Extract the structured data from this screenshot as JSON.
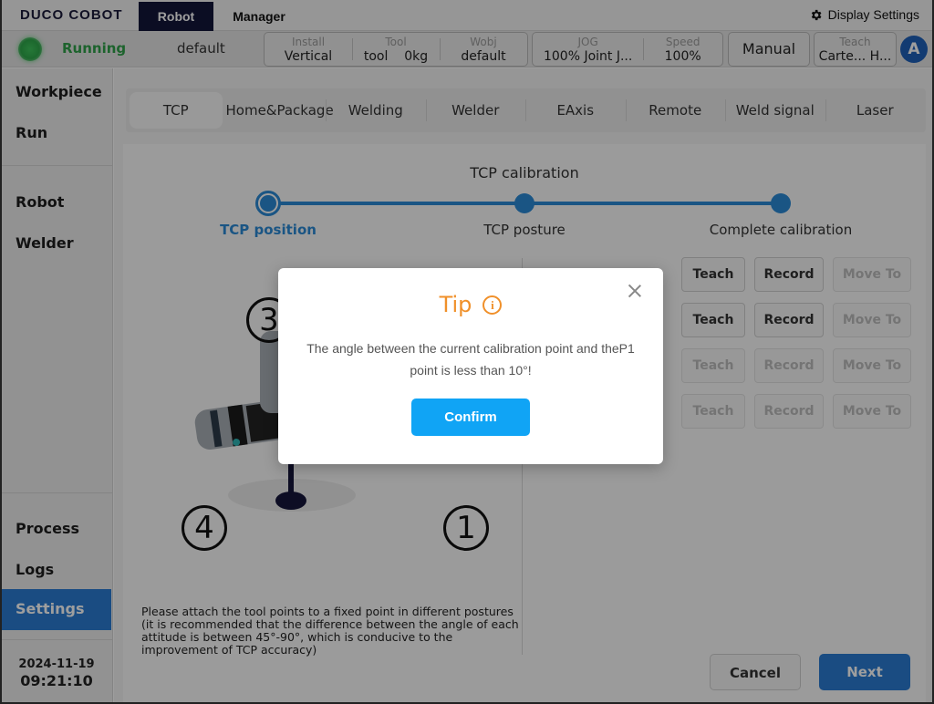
{
  "topbar": {
    "logo": "DUCO COBOT",
    "tabs": [
      {
        "label": "Robot"
      },
      {
        "label": "Manager"
      }
    ],
    "display_settings": "Display Settings"
  },
  "status": {
    "state": "Running",
    "profile": "default",
    "install": {
      "label": "Install",
      "value": "Vertical"
    },
    "tool": {
      "label": "Tool",
      "value": "tool",
      "weight": "0kg"
    },
    "wobj": {
      "label": "Wobj",
      "value": "default"
    },
    "jog": {
      "label": "JOG",
      "value": "100% Joint J..."
    },
    "speed": {
      "label": "Speed",
      "value": "100%"
    },
    "mode": "Manual",
    "teach": {
      "label": "Teach",
      "value": "Carte... H..."
    },
    "avatar": "A"
  },
  "sidebar": {
    "items": [
      {
        "label": "Workpiece"
      },
      {
        "label": "Run"
      },
      {
        "label": "Robot"
      },
      {
        "label": "Welder"
      },
      {
        "label": "Process"
      },
      {
        "label": "Logs"
      },
      {
        "label": "Settings"
      }
    ],
    "date": "2024-11-19",
    "time": "09:21:10"
  },
  "main": {
    "tabs": [
      {
        "label": "TCP"
      },
      {
        "label": "Home&Package"
      },
      {
        "label": "Welding"
      },
      {
        "label": "Welder"
      },
      {
        "label": "EAxis"
      },
      {
        "label": "Remote"
      },
      {
        "label": "Weld signal"
      },
      {
        "label": "Laser"
      }
    ],
    "title": "TCP calibration",
    "steps": [
      {
        "label": "TCP position"
      },
      {
        "label": "TCP posture"
      },
      {
        "label": "Complete calibration"
      }
    ],
    "illustration_numbers": [
      "3",
      "4",
      "1"
    ],
    "hint": "Please attach the tool points to a fixed point in different postures (it is recommended that the difference between the angle of each attitude is between 45°-90°, which is conducive to the improvement of TCP accuracy)",
    "point_buttons": {
      "teach": "Teach",
      "record": "Record",
      "move": "Move To"
    },
    "cancel": "Cancel",
    "next": "Next"
  },
  "dialog": {
    "title": "Tip",
    "message": "The angle between the current calibration point and theP1 point is less than 10°!",
    "confirm": "Confirm"
  },
  "colors": {
    "nav_active": "#121639",
    "accent": "#2a7bd2",
    "running": "#2fa14a",
    "tip": "#f0902a",
    "confirm": "#10a4f5"
  }
}
